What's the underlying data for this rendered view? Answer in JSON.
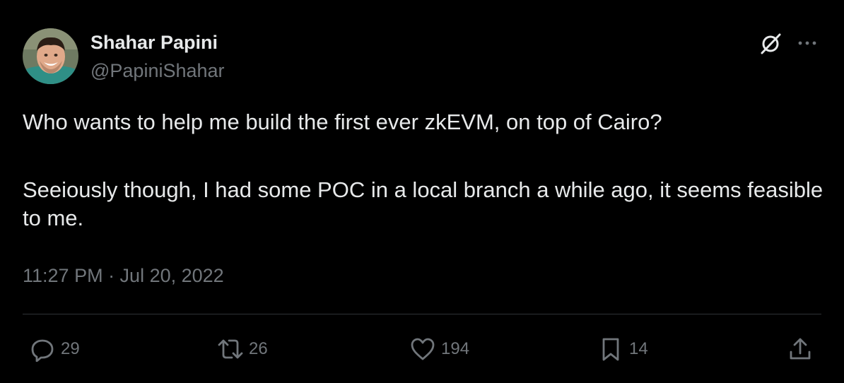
{
  "author": {
    "display_name": "Shahar Papini",
    "handle": "@PapiniShahar"
  },
  "tweet": {
    "line1": "Who wants to help me build the first ever zkEVM, on top of Cairo?",
    "line2": "Seeiously though, I had some POC in a local branch a while ago, it seems feasible to me.",
    "timestamp": "11:27 PM · Jul 20, 2022"
  },
  "actions": {
    "replies": "29",
    "retweets": "26",
    "likes": "194",
    "bookmarks": "14"
  },
  "icons": [
    "grok-icon",
    "more-icon",
    "reply-icon",
    "retweet-icon",
    "like-icon",
    "bookmark-icon",
    "share-icon"
  ],
  "colors": {
    "background": "#000000",
    "text": "#e7e9ea",
    "secondary": "#71767b",
    "divider": "#2f3336"
  }
}
